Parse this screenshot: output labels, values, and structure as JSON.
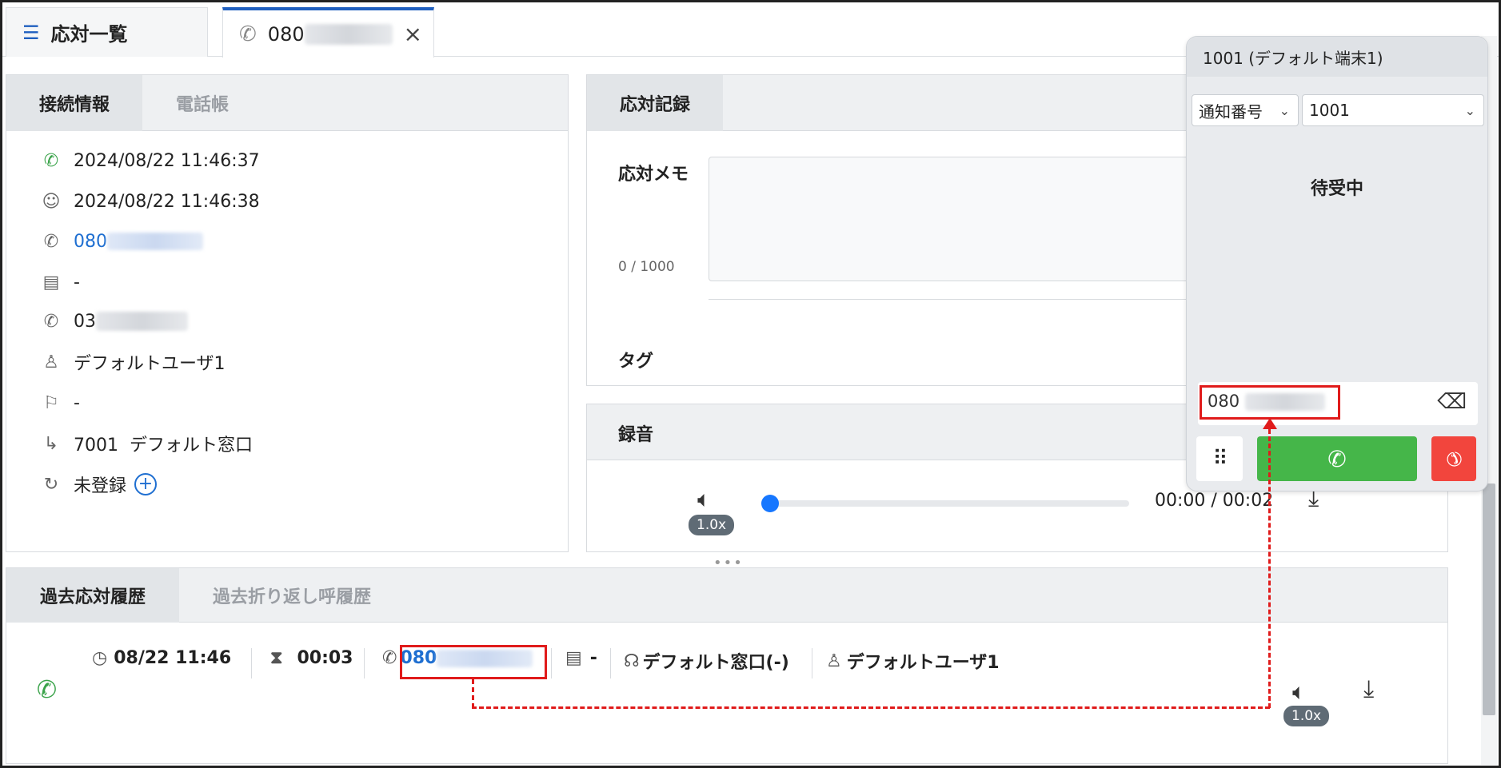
{
  "tabs": {
    "list_label": "応対一覧",
    "call_prefix": "080"
  },
  "connection": {
    "tab_active": "接続情報",
    "tab_inactive": "電話帳",
    "rows": [
      {
        "icon": "incoming-call-icon",
        "value": "2024/08/22 11:46:37"
      },
      {
        "icon": "agent-icon",
        "value": "2024/08/22 11:46:38"
      },
      {
        "icon": "phone-icon",
        "value": "080"
      },
      {
        "icon": "contact-card-icon",
        "value": "-"
      },
      {
        "icon": "phone-ring-icon",
        "value": "03"
      },
      {
        "icon": "user-icon",
        "value": "デフォルトユーザ1"
      },
      {
        "icon": "bookmark-icon",
        "value": "-"
      },
      {
        "icon": "route-icon",
        "value": "7001  デフォルト窓口"
      },
      {
        "icon": "callback-icon",
        "value": "未登録"
      }
    ]
  },
  "record": {
    "tab": "応対記録",
    "memo_label": "応対メモ",
    "memo_counter": "0 / 1000",
    "tag_label": "タグ"
  },
  "recording": {
    "title": "録音",
    "speed": "1.0x",
    "time": "00:00 / 00:02"
  },
  "history": {
    "tab_active": "過去応対履歴",
    "tab_inactive": "過去折り返し呼履歴",
    "entry": {
      "datetime": "08/22 11:46",
      "duration": "00:03",
      "phone": "080",
      "contact": "-",
      "queue": "デフォルト窓口(-)",
      "user": "デフォルトユーザ1",
      "speed": "1.0x"
    }
  },
  "phone": {
    "header": "1001 (デフォルト端末1)",
    "caller_select": "通知番号",
    "line_select": "1001",
    "status": "待受中",
    "dial_value": "080"
  },
  "colors": {
    "accent_blue": "#1f5fbf",
    "call_green": "#45b649",
    "hangup_red": "#f2453d",
    "annotation_red": "#e01b1b"
  }
}
